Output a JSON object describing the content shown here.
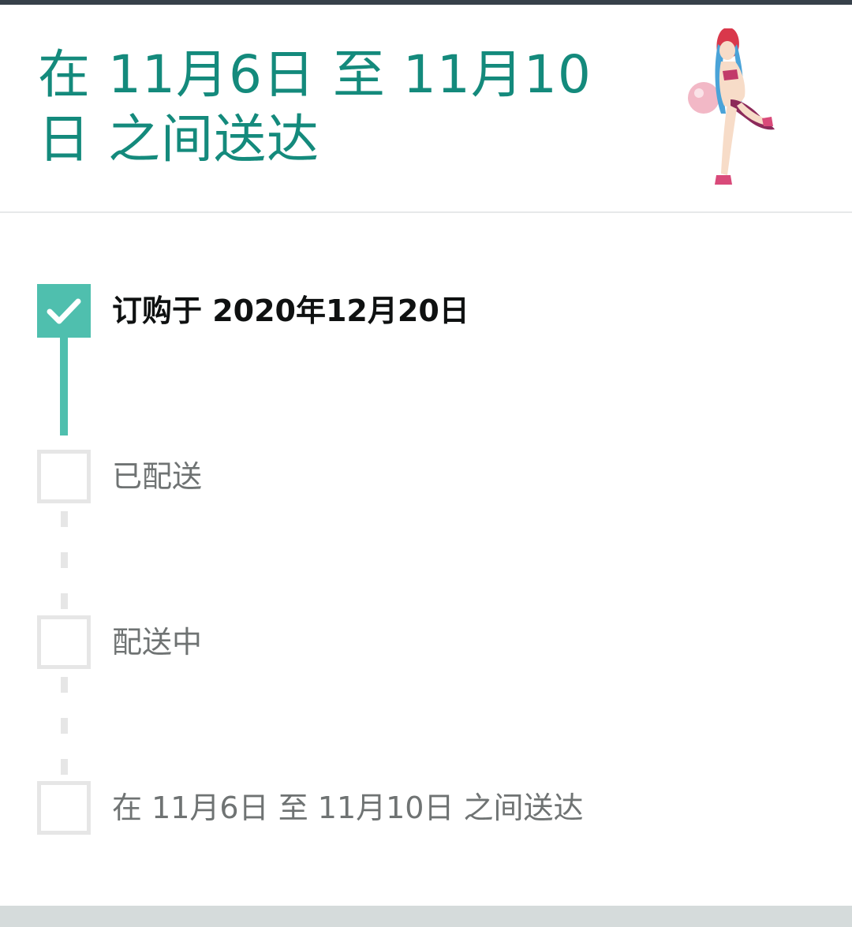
{
  "header": {
    "title": "在 11月6日 至 11月10日 之间送达",
    "product_image": "anime-figure-product-thumbnail"
  },
  "timeline": {
    "steps": [
      {
        "label": "订购于 2020年12月20日",
        "status": "complete",
        "icon": "check-icon"
      },
      {
        "label": "已配送",
        "status": "pending"
      },
      {
        "label": "配送中",
        "status": "pending"
      },
      {
        "label": "在 11月6日 至 11月10日 之间送达",
        "status": "pending"
      }
    ]
  },
  "colors": {
    "accent": "#148a7c",
    "progress": "#4fbfae",
    "pending": "#e6e6e6",
    "top_bar": "#37414a",
    "bottom_band": "#d5dbdb"
  }
}
